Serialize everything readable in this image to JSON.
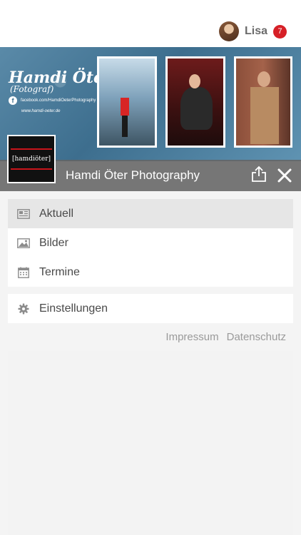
{
  "user": {
    "name": "Lisa",
    "notifications": "7"
  },
  "banner": {
    "brand_title": "Hamdi Öter",
    "brand_subtitle": "(Fotograf)",
    "facebook_text": "facebook.com/HamdiOeterPhotography",
    "website_text": "www.hamdi-oeter.de",
    "logo_text": "[hamdiöter]"
  },
  "page": {
    "title": "Hamdi Öter Photography"
  },
  "menu": {
    "items": [
      {
        "label": "Aktuell",
        "icon": "newspaper-icon",
        "active": true
      },
      {
        "label": "Bilder",
        "icon": "image-icon",
        "active": false
      },
      {
        "label": "Termine",
        "icon": "calendar-icon",
        "active": false
      }
    ],
    "settings_label": "Einstellungen"
  },
  "footer": {
    "impressum": "Impressum",
    "datenschutz": "Datenschutz"
  },
  "colors": {
    "badge": "#d62027",
    "titlebar": "#646464",
    "banner": "#4f84a4"
  }
}
